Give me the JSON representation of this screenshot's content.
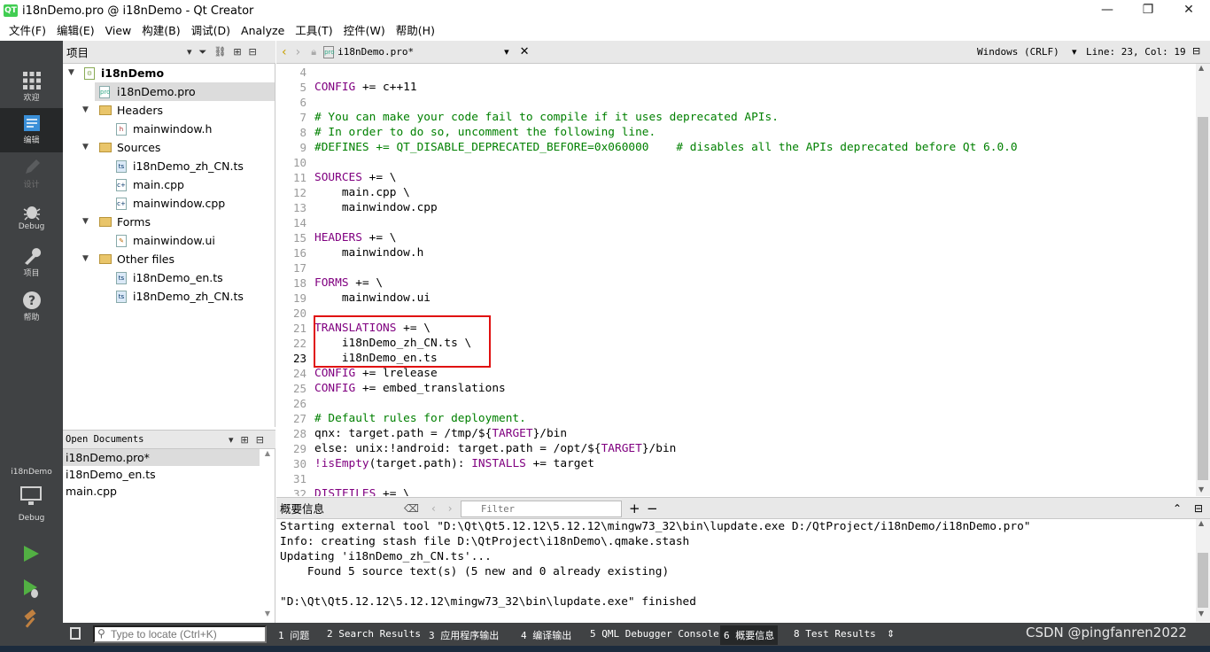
{
  "window": {
    "title": "i18nDemo.pro @ i18nDemo - Qt Creator",
    "logo": "QT"
  },
  "menu": [
    "文件(F)",
    "编辑(E)",
    "View",
    "构建(B)",
    "调试(D)",
    "Analyze",
    "工具(T)",
    "控件(W)",
    "帮助(H)"
  ],
  "modes": [
    {
      "label": "欢迎",
      "icon": "grid-icon"
    },
    {
      "label": "编辑",
      "icon": "edit-icon"
    },
    {
      "label": "设计",
      "icon": "pen-icon"
    },
    {
      "label": "Debug",
      "icon": "bug-icon"
    },
    {
      "label": "项目",
      "icon": "wrench-icon"
    },
    {
      "label": "帮助",
      "icon": "help-icon"
    }
  ],
  "kit": {
    "name": "i18nDemo",
    "config": "Debug"
  },
  "project_panel": {
    "title": "项目",
    "tree": [
      {
        "label": "i18nDemo"
      },
      {
        "label": "i18nDemo.pro"
      },
      {
        "label": "Headers"
      },
      {
        "label": "mainwindow.h"
      },
      {
        "label": "Sources"
      },
      {
        "label": "i18nDemo_zh_CN.ts"
      },
      {
        "label": "main.cpp"
      },
      {
        "label": "mainwindow.cpp"
      },
      {
        "label": "Forms"
      },
      {
        "label": "mainwindow.ui"
      },
      {
        "label": "Other files"
      },
      {
        "label": "i18nDemo_en.ts"
      },
      {
        "label": "i18nDemo_zh_CN.ts"
      }
    ]
  },
  "open_documents": {
    "title": "Open Documents",
    "items": [
      "i18nDemo.pro*",
      "i18nDemo_en.ts",
      "main.cpp"
    ]
  },
  "editor": {
    "file": "i18nDemo.pro*",
    "encoding": "Windows (CRLF)",
    "position": "Line: 23, Col: 19",
    "lines": [
      {
        "n": "4",
        "text": ""
      },
      {
        "n": "5",
        "text": "CONFIG += c++11"
      },
      {
        "n": "6",
        "text": ""
      },
      {
        "n": "7",
        "text": "# You can make your code fail to compile if it uses deprecated APIs."
      },
      {
        "n": "8",
        "text": "# In order to do so, uncomment the following line."
      },
      {
        "n": "9",
        "text": "#DEFINES += QT_DISABLE_DEPRECATED_BEFORE=0x060000    # disables all the APIs deprecated before Qt 6.0.0"
      },
      {
        "n": "10",
        "text": ""
      },
      {
        "n": "11",
        "text": "SOURCES += \\"
      },
      {
        "n": "12",
        "text": "    main.cpp \\"
      },
      {
        "n": "13",
        "text": "    mainwindow.cpp"
      },
      {
        "n": "14",
        "text": ""
      },
      {
        "n": "15",
        "text": "HEADERS += \\"
      },
      {
        "n": "16",
        "text": "    mainwindow.h"
      },
      {
        "n": "17",
        "text": ""
      },
      {
        "n": "18",
        "text": "FORMS += \\"
      },
      {
        "n": "19",
        "text": "    mainwindow.ui"
      },
      {
        "n": "20",
        "text": ""
      },
      {
        "n": "21",
        "text": "TRANSLATIONS += \\"
      },
      {
        "n": "22",
        "text": "    i18nDemo_zh_CN.ts \\"
      },
      {
        "n": "23",
        "text": "    i18nDemo_en.ts"
      },
      {
        "n": "24",
        "text": "CONFIG += lrelease"
      },
      {
        "n": "25",
        "text": "CONFIG += embed_translations"
      },
      {
        "n": "26",
        "text": ""
      },
      {
        "n": "27",
        "text": "# Default rules for deployment."
      },
      {
        "n": "28",
        "text": "qnx: target.path = /tmp/$${TARGET}/bin"
      },
      {
        "n": "29",
        "text": "else: unix:!android: target.path = /opt/$${TARGET}/bin"
      },
      {
        "n": "30",
        "text": "!isEmpty(target.path): INSTALLS += target"
      },
      {
        "n": "31",
        "text": ""
      },
      {
        "n": "32",
        "text": "DISTFILES += \\"
      }
    ]
  },
  "output": {
    "title": "概要信息",
    "filter_placeholder": "Filter",
    "lines": [
      "Starting external tool \"D:\\Qt\\Qt5.12.12\\5.12.12\\mingw73_32\\bin\\lupdate.exe D:/QtProject/i18nDemo/i18nDemo.pro\"",
      "Info: creating stash file D:\\QtProject\\i18nDemo\\.qmake.stash",
      "Updating 'i18nDemo_zh_CN.ts'...",
      "    Found 5 source text(s) (5 new and 0 already existing)",
      "",
      "\"D:\\Qt\\Qt5.12.12\\5.12.12\\mingw73_32\\bin\\lupdate.exe\" finished"
    ]
  },
  "statusbar": {
    "locator_placeholder": "Type to locate (Ctrl+K)",
    "tabs": [
      "1 问题",
      "2 Search Results",
      "3 应用程序输出",
      "4 编译输出",
      "5 QML Debugger Console",
      "6 概要信息",
      "8 Test Results"
    ]
  },
  "watermark": "CSDN @pingfanren2022"
}
